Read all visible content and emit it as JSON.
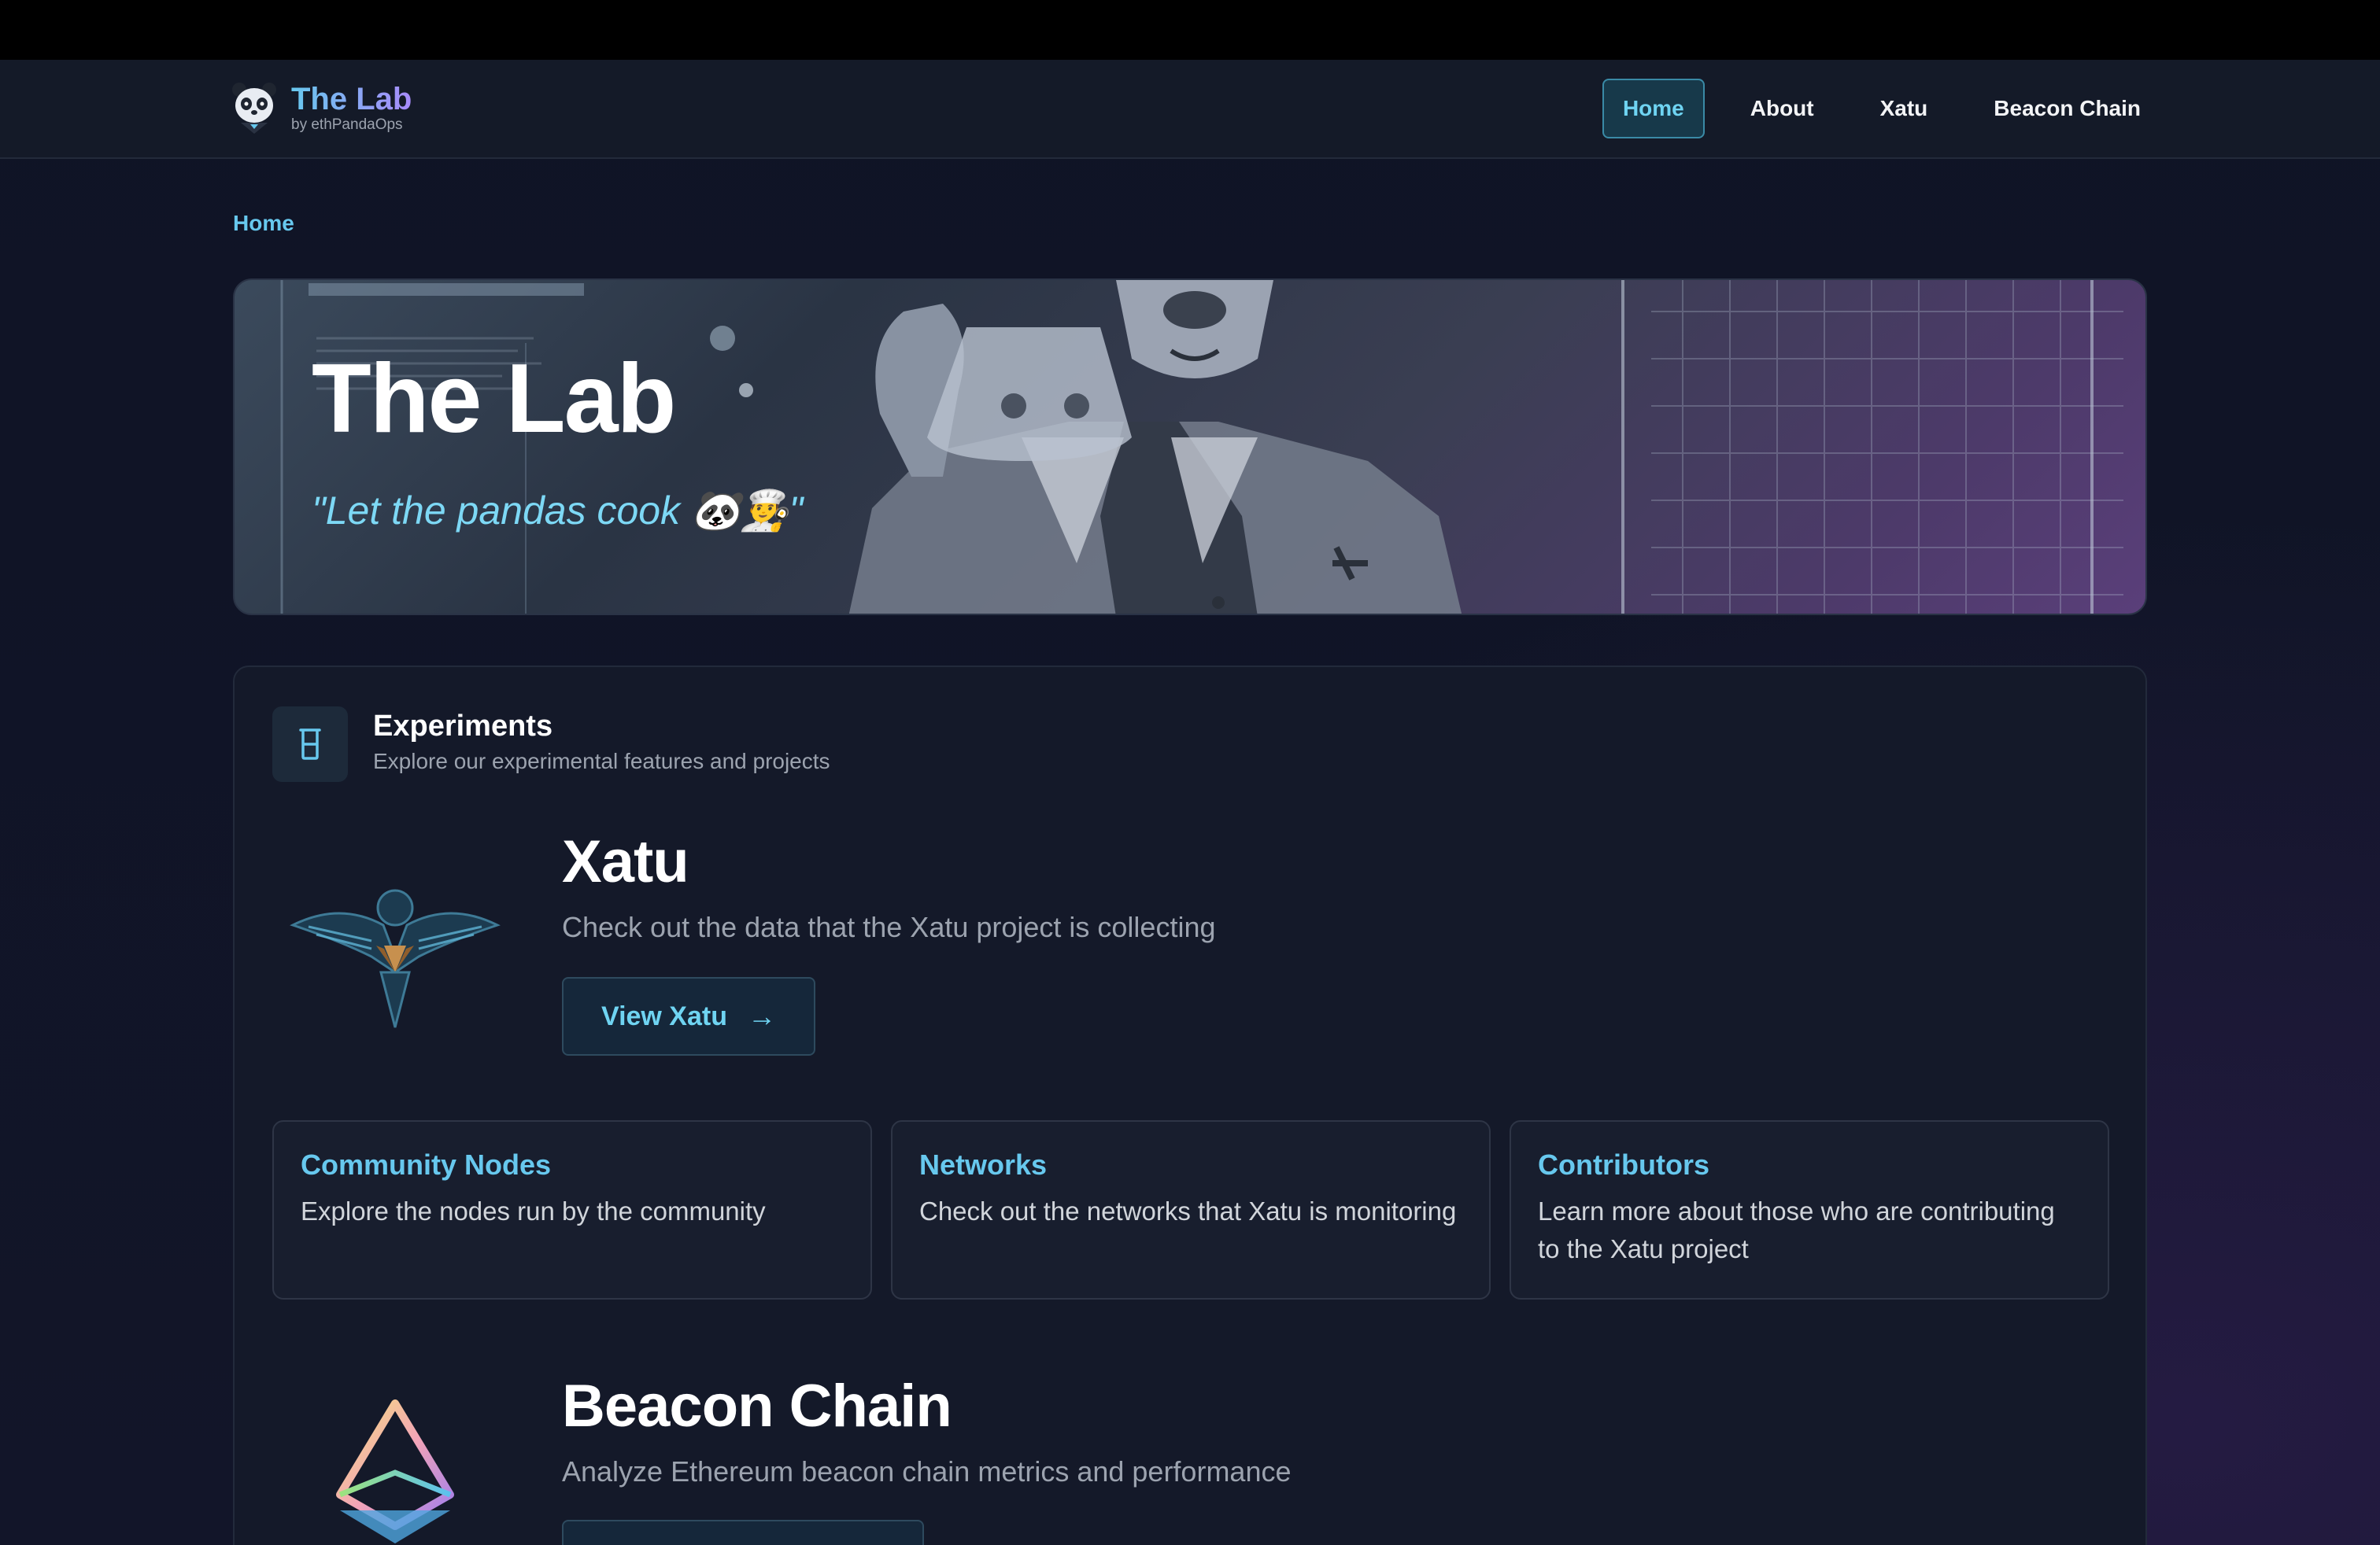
{
  "brand": {
    "title": "The Lab",
    "subtitle": "by ethPandaOps"
  },
  "nav": {
    "items": [
      {
        "label": "Home",
        "active": true
      },
      {
        "label": "About"
      },
      {
        "label": "Xatu"
      },
      {
        "label": "Beacon Chain"
      }
    ]
  },
  "breadcrumb": {
    "items": [
      "Home"
    ]
  },
  "hero": {
    "title": "The Lab",
    "quote": "\"Let the pandas cook 🐼👨‍🍳\""
  },
  "experiments": {
    "title": "Experiments",
    "subtitle": "Explore our experimental features and projects",
    "projects": [
      {
        "title": "Xatu",
        "description": "Check out the data that the Xatu project is collecting",
        "button_label": "View Xatu",
        "links": [
          {
            "title": "Community Nodes",
            "description": "Explore the nodes run by the community"
          },
          {
            "title": "Networks",
            "description": "Check out the networks that Xatu is monitoring"
          },
          {
            "title": "Contributors",
            "description": "Learn more about those who are contributing to the Xatu project"
          }
        ]
      },
      {
        "title": "Beacon Chain",
        "description": "Analyze Ethereum beacon chain metrics and performance"
      }
    ]
  },
  "colors": {
    "accent": "#67c8ee",
    "brand_gradient_end": "#a78bfa",
    "background": "#0f1220"
  },
  "icons": {
    "logo": "panda-logo-icon",
    "experiments": "beaker-icon",
    "xatu": "xatu-bird-logo",
    "beacon": "ethereum-logo",
    "arrow": "arrow-right-icon"
  }
}
